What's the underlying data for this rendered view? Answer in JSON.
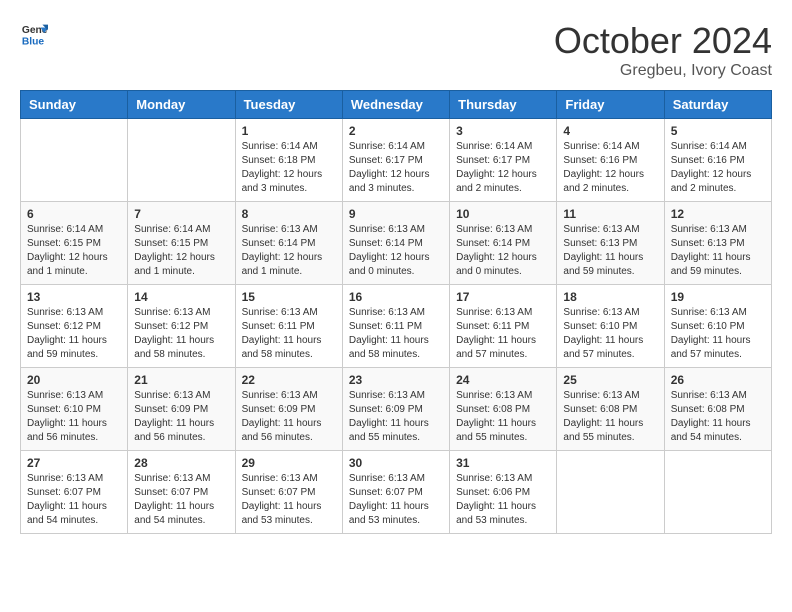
{
  "header": {
    "logo_line1": "General",
    "logo_line2": "Blue",
    "month": "October 2024",
    "location": "Gregbeu, Ivory Coast"
  },
  "days_of_week": [
    "Sunday",
    "Monday",
    "Tuesday",
    "Wednesday",
    "Thursday",
    "Friday",
    "Saturday"
  ],
  "weeks": [
    [
      {
        "day": "",
        "info": ""
      },
      {
        "day": "",
        "info": ""
      },
      {
        "day": "1",
        "info": "Sunrise: 6:14 AM\nSunset: 6:18 PM\nDaylight: 12 hours and 3 minutes."
      },
      {
        "day": "2",
        "info": "Sunrise: 6:14 AM\nSunset: 6:17 PM\nDaylight: 12 hours and 3 minutes."
      },
      {
        "day": "3",
        "info": "Sunrise: 6:14 AM\nSunset: 6:17 PM\nDaylight: 12 hours and 2 minutes."
      },
      {
        "day": "4",
        "info": "Sunrise: 6:14 AM\nSunset: 6:16 PM\nDaylight: 12 hours and 2 minutes."
      },
      {
        "day": "5",
        "info": "Sunrise: 6:14 AM\nSunset: 6:16 PM\nDaylight: 12 hours and 2 minutes."
      }
    ],
    [
      {
        "day": "6",
        "info": "Sunrise: 6:14 AM\nSunset: 6:15 PM\nDaylight: 12 hours and 1 minute."
      },
      {
        "day": "7",
        "info": "Sunrise: 6:14 AM\nSunset: 6:15 PM\nDaylight: 12 hours and 1 minute."
      },
      {
        "day": "8",
        "info": "Sunrise: 6:13 AM\nSunset: 6:14 PM\nDaylight: 12 hours and 1 minute."
      },
      {
        "day": "9",
        "info": "Sunrise: 6:13 AM\nSunset: 6:14 PM\nDaylight: 12 hours and 0 minutes."
      },
      {
        "day": "10",
        "info": "Sunrise: 6:13 AM\nSunset: 6:14 PM\nDaylight: 12 hours and 0 minutes."
      },
      {
        "day": "11",
        "info": "Sunrise: 6:13 AM\nSunset: 6:13 PM\nDaylight: 11 hours and 59 minutes."
      },
      {
        "day": "12",
        "info": "Sunrise: 6:13 AM\nSunset: 6:13 PM\nDaylight: 11 hours and 59 minutes."
      }
    ],
    [
      {
        "day": "13",
        "info": "Sunrise: 6:13 AM\nSunset: 6:12 PM\nDaylight: 11 hours and 59 minutes."
      },
      {
        "day": "14",
        "info": "Sunrise: 6:13 AM\nSunset: 6:12 PM\nDaylight: 11 hours and 58 minutes."
      },
      {
        "day": "15",
        "info": "Sunrise: 6:13 AM\nSunset: 6:11 PM\nDaylight: 11 hours and 58 minutes."
      },
      {
        "day": "16",
        "info": "Sunrise: 6:13 AM\nSunset: 6:11 PM\nDaylight: 11 hours and 58 minutes."
      },
      {
        "day": "17",
        "info": "Sunrise: 6:13 AM\nSunset: 6:11 PM\nDaylight: 11 hours and 57 minutes."
      },
      {
        "day": "18",
        "info": "Sunrise: 6:13 AM\nSunset: 6:10 PM\nDaylight: 11 hours and 57 minutes."
      },
      {
        "day": "19",
        "info": "Sunrise: 6:13 AM\nSunset: 6:10 PM\nDaylight: 11 hours and 57 minutes."
      }
    ],
    [
      {
        "day": "20",
        "info": "Sunrise: 6:13 AM\nSunset: 6:10 PM\nDaylight: 11 hours and 56 minutes."
      },
      {
        "day": "21",
        "info": "Sunrise: 6:13 AM\nSunset: 6:09 PM\nDaylight: 11 hours and 56 minutes."
      },
      {
        "day": "22",
        "info": "Sunrise: 6:13 AM\nSunset: 6:09 PM\nDaylight: 11 hours and 56 minutes."
      },
      {
        "day": "23",
        "info": "Sunrise: 6:13 AM\nSunset: 6:09 PM\nDaylight: 11 hours and 55 minutes."
      },
      {
        "day": "24",
        "info": "Sunrise: 6:13 AM\nSunset: 6:08 PM\nDaylight: 11 hours and 55 minutes."
      },
      {
        "day": "25",
        "info": "Sunrise: 6:13 AM\nSunset: 6:08 PM\nDaylight: 11 hours and 55 minutes."
      },
      {
        "day": "26",
        "info": "Sunrise: 6:13 AM\nSunset: 6:08 PM\nDaylight: 11 hours and 54 minutes."
      }
    ],
    [
      {
        "day": "27",
        "info": "Sunrise: 6:13 AM\nSunset: 6:07 PM\nDaylight: 11 hours and 54 minutes."
      },
      {
        "day": "28",
        "info": "Sunrise: 6:13 AM\nSunset: 6:07 PM\nDaylight: 11 hours and 54 minutes."
      },
      {
        "day": "29",
        "info": "Sunrise: 6:13 AM\nSunset: 6:07 PM\nDaylight: 11 hours and 53 minutes."
      },
      {
        "day": "30",
        "info": "Sunrise: 6:13 AM\nSunset: 6:07 PM\nDaylight: 11 hours and 53 minutes."
      },
      {
        "day": "31",
        "info": "Sunrise: 6:13 AM\nSunset: 6:06 PM\nDaylight: 11 hours and 53 minutes."
      },
      {
        "day": "",
        "info": ""
      },
      {
        "day": "",
        "info": ""
      }
    ]
  ]
}
